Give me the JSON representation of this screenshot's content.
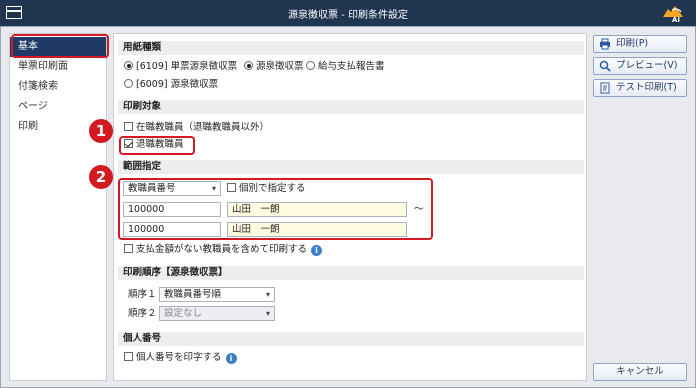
{
  "window": {
    "title": "源泉徴収票 - 印刷条件設定",
    "logo_text": "AI"
  },
  "sidebar": {
    "items": [
      {
        "label": "基本",
        "active": true
      },
      {
        "label": "単票印刷面",
        "active": false
      },
      {
        "label": "付箋検索",
        "active": false
      },
      {
        "label": "ページ",
        "active": false
      },
      {
        "label": "印刷",
        "active": false
      }
    ]
  },
  "paper_type": {
    "header": "用紙種類",
    "opt1": "[6109] 単票源泉徴収票",
    "opt2": "源泉徴収票",
    "opt3": "給与支払報告書",
    "opt4": "[6009] 源泉徴収票",
    "selected": "[6109] 単票源泉徴収票"
  },
  "print_target": {
    "header": "印刷対象",
    "current_label": "在職教職員（退職教職員以外）",
    "current_checked": false,
    "retired_label": "退職教職員",
    "retired_checked": true
  },
  "range": {
    "header": "範囲指定",
    "field_select": "教職員番号",
    "individual_label": "個別で指定する",
    "individual_checked": false,
    "from_code": "100000",
    "from_name": "山田　一朗",
    "tilde": "～",
    "to_code": "100000",
    "to_name": "山田　一朗",
    "include_zero_label": "支払金額がない教職員を含めて印刷する",
    "include_zero_checked": false
  },
  "print_order": {
    "header": "印刷順序【源泉徴収票】",
    "order1_label": "順序１",
    "order1_value": "教職員番号順",
    "order2_label": "順序２",
    "order2_value": "設定なし"
  },
  "personal_number": {
    "header": "個人番号",
    "label": "個人番号を印字する",
    "checked": false
  },
  "annotations": {
    "badge1": "1",
    "badge2": "2"
  },
  "buttons": {
    "print": "印刷(P)",
    "preview": "プレビュー(V)",
    "test_print": "テスト印刷(T)",
    "cancel": "キャンセル"
  },
  "icons": {
    "info": "i",
    "caret": "▾"
  },
  "colors": {
    "titlebar": "#1f3550",
    "sidebar_active": "#1f3a66",
    "annotation_red": "#d31a20",
    "name_field_bg": "#fffbe0",
    "info_blue": "#3b7fd0"
  }
}
